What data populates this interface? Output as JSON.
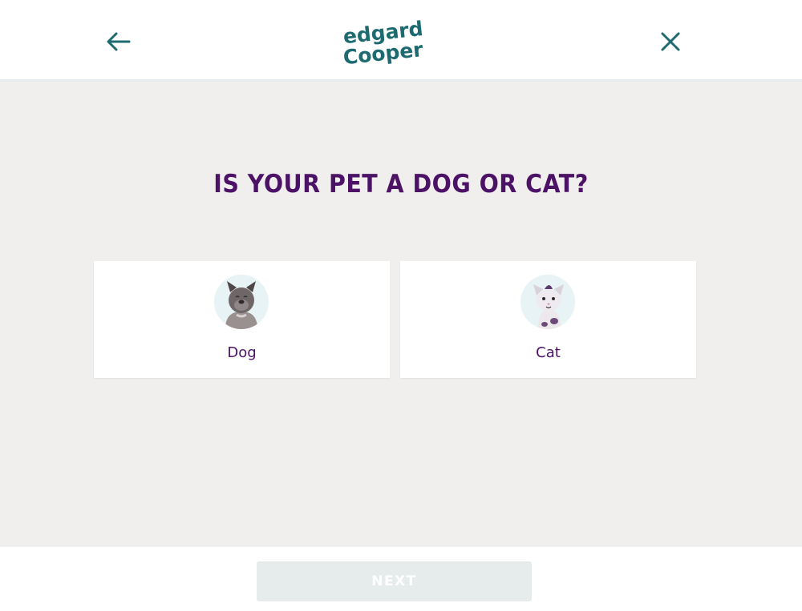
{
  "header": {
    "logo_line1": "edgard",
    "logo_line2": "Cooper"
  },
  "question": "IS YOUR PET A DOG OR CAT?",
  "options": [
    {
      "label": "Dog",
      "icon": "dog-icon"
    },
    {
      "label": "Cat",
      "icon": "cat-icon"
    }
  ],
  "footer": {
    "next_label": "NEXT",
    "next_enabled": false
  },
  "colors": {
    "brand_teal": "#1d6b70",
    "heading_purple": "#4b1266",
    "background": "#f1eeee",
    "disabled_button": "#e6ecec"
  }
}
